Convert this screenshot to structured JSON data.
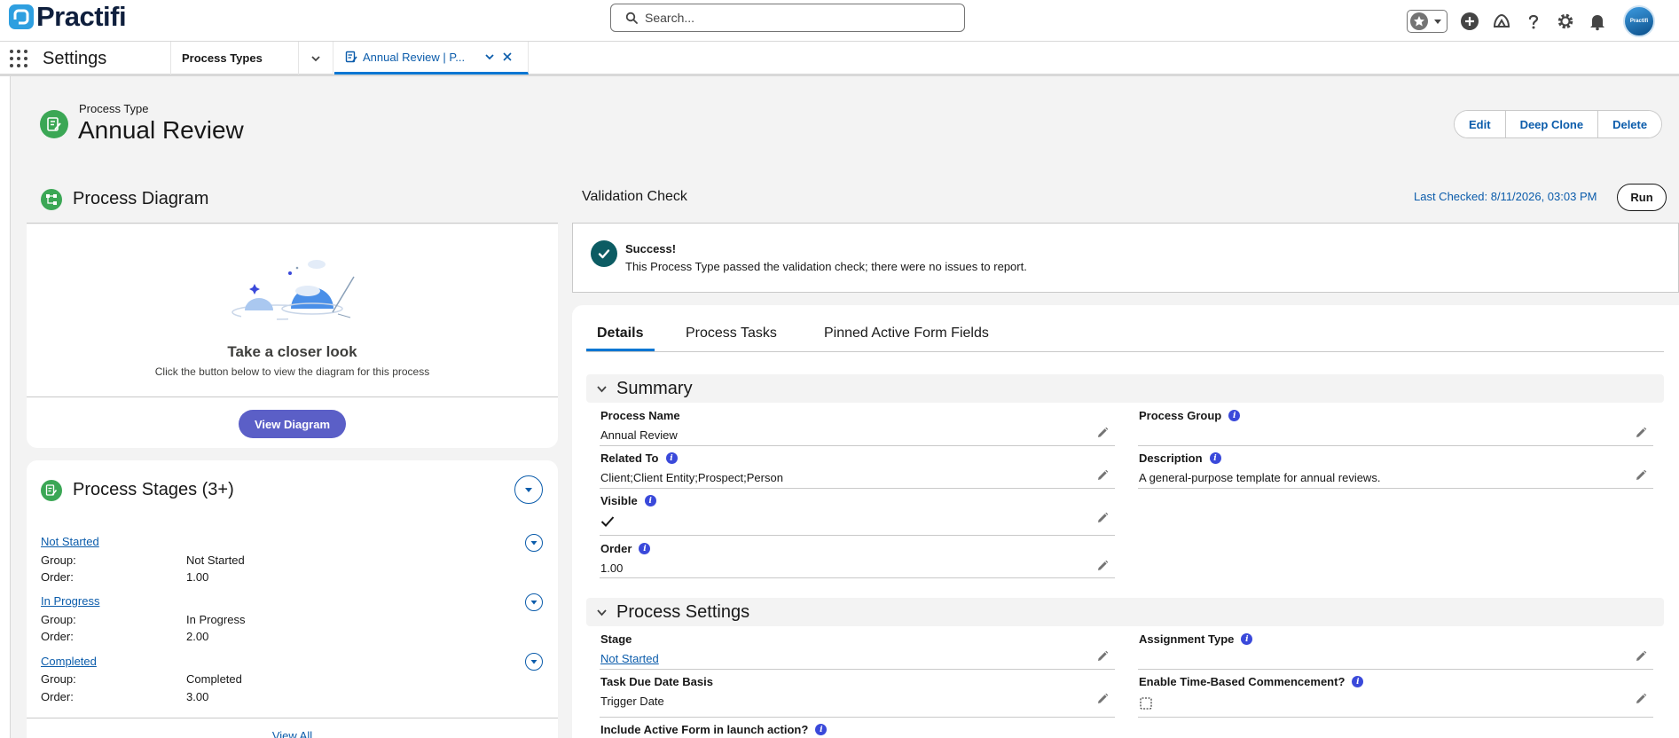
{
  "app": {
    "logo_text": "Practifi",
    "search_placeholder": "Search...",
    "avatar_text": "Practifi"
  },
  "nav": {
    "app_name": "Settings",
    "tabs": [
      {
        "label": "Process Types"
      },
      {
        "label": "Annual Review | P..."
      }
    ]
  },
  "header": {
    "object_type": "Process Type",
    "record_name": "Annual Review",
    "buttons": {
      "edit": "Edit",
      "deep_clone": "Deep Clone",
      "delete": "Delete"
    }
  },
  "process_diagram": {
    "title": "Process Diagram",
    "empty_title": "Take a closer look",
    "empty_text": "Click the button below to view the diagram for this process",
    "button": "View Diagram"
  },
  "process_stages": {
    "title": "Process Stages (3+)",
    "group_label": "Group:",
    "order_label": "Order:",
    "items": [
      {
        "name": "Not Started",
        "group": "Not Started",
        "order": "1.00"
      },
      {
        "name": "In Progress",
        "group": "In Progress",
        "order": "2.00"
      },
      {
        "name": "Completed",
        "group": "Completed",
        "order": "3.00"
      }
    ],
    "view_all": "View All"
  },
  "validation": {
    "title": "Validation Check",
    "last_checked": "Last Checked: 8/11/2026, 03:03 PM",
    "run_button": "Run",
    "status_title": "Success!",
    "status_message": "This Process Type passed the validation check; there were no issues to report."
  },
  "details": {
    "tabs": [
      "Details",
      "Process Tasks",
      "Pinned Active Form Fields"
    ],
    "summary": {
      "title": "Summary",
      "process_name_label": "Process Name",
      "process_name": "Annual Review",
      "process_group_label": "Process Group",
      "process_group": "",
      "related_to_label": "Related To",
      "related_to": "Client;Client Entity;Prospect;Person",
      "description_label": "Description",
      "description": "A general-purpose template for annual reviews.",
      "visible_label": "Visible",
      "visible": true,
      "order_label": "Order",
      "order": "1.00"
    },
    "process_settings": {
      "title": "Process Settings",
      "stage_label": "Stage",
      "stage": "Not Started",
      "assignment_type_label": "Assignment Type",
      "assignment_type": "",
      "task_due_date_basis_label": "Task Due Date Basis",
      "task_due_date_basis": "Trigger Date",
      "enable_time_label": "Enable Time-Based Commencement?",
      "enable_time": false,
      "include_active_form_label": "Include Active Form in launch action?"
    }
  },
  "colors": {
    "brand_blue": "#0176d3",
    "link_blue": "#0b5cab",
    "icon_green": "#3ba755",
    "success_teal": "#0c5c63",
    "diagram_button": "#5b5fc7",
    "info_blue": "#3a49da"
  }
}
